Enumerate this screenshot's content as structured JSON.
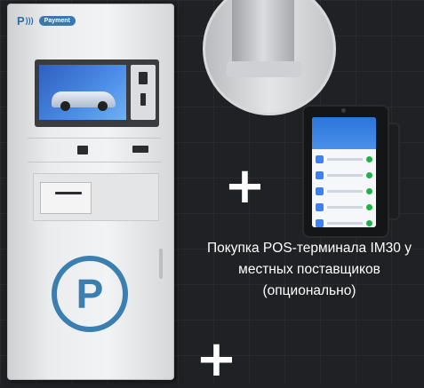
{
  "kiosk": {
    "brand_badge": "Payment",
    "icons": [
      "parking-p-icon"
    ]
  },
  "plus_top": "+",
  "plus_bottom": "+",
  "caption": "Покупка POS-терминала IM30 у местных поставщиков (опционально)",
  "colors": {
    "background": "#1f2124",
    "accent": "#3a7fb0",
    "text": "#ffffff"
  }
}
